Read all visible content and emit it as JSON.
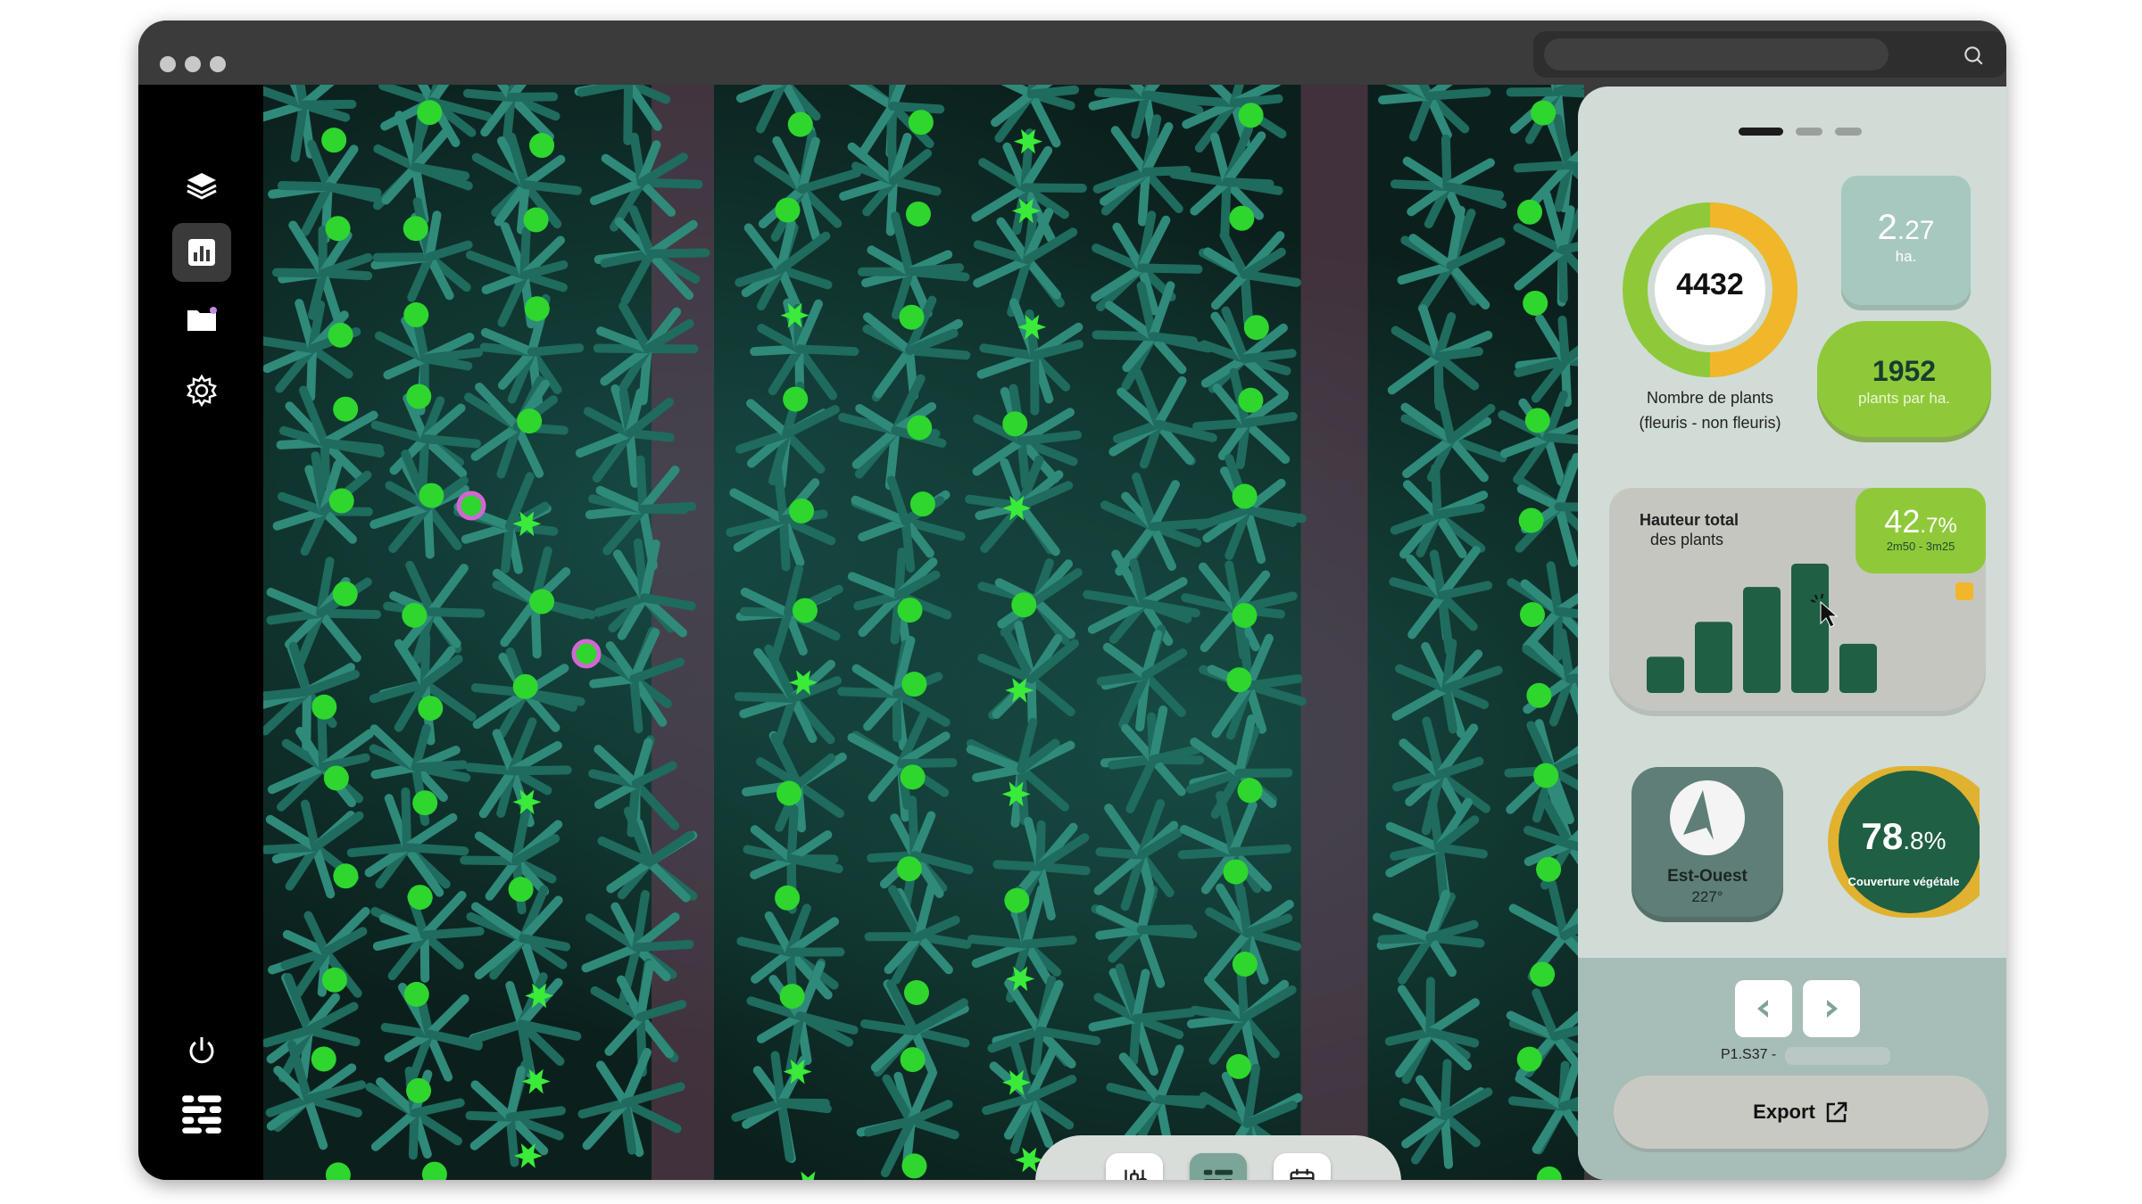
{
  "window": {
    "search": {
      "placeholder": ""
    }
  },
  "sidebar": {
    "items": [
      {
        "icon": "layers-icon",
        "active": false
      },
      {
        "icon": "bar-chart-icon",
        "active": true
      },
      {
        "icon": "folder-icon",
        "active": false
      },
      {
        "icon": "gear-icon",
        "active": false
      }
    ],
    "bottom": [
      {
        "icon": "power-icon"
      },
      {
        "icon": "app-logo-icon"
      }
    ]
  },
  "toolbar": {
    "buttons": [
      {
        "icon": "sliders-icon",
        "active": false
      },
      {
        "icon": "table-icon",
        "active": true
      },
      {
        "icon": "calendar-icon",
        "active": false
      }
    ]
  },
  "panel": {
    "pager": {
      "count": 3,
      "active": 0
    },
    "plants": {
      "count": "4432",
      "caption_line1": "Nombre de plants",
      "caption_line2": "(fleuris - non fleuris)",
      "flowered_fraction": 0.5
    },
    "area": {
      "integer": "2",
      "decimal": ".27",
      "unit": "ha."
    },
    "density": {
      "value": "1952",
      "unit": "plants par ha."
    },
    "height": {
      "title": "Hauteur total",
      "subtitle": "des plants",
      "percent_int": "42",
      "percent_dec": ".7%",
      "range": "2m50 - 3m25",
      "bars": [
        0.28,
        0.55,
        0.82,
        1.0,
        0.38
      ]
    },
    "orientation": {
      "label": "Est-Ouest",
      "degrees": "227°"
    },
    "coverage": {
      "percent_int": "78",
      "percent_dec": ".8%",
      "label": "Couverture végétale"
    },
    "footer": {
      "plot_id": "P1.S37 -",
      "export_label": "Export"
    }
  },
  "colors": {
    "accent_green": "#8fc93a",
    "dark_green": "#1f5f44",
    "orange": "#f0b72a",
    "teal_card": "#a6c8bf",
    "flower_marker": "#3aeb3a",
    "plant_marker": "#2ed62e",
    "selected_marker": "#d466d4"
  }
}
